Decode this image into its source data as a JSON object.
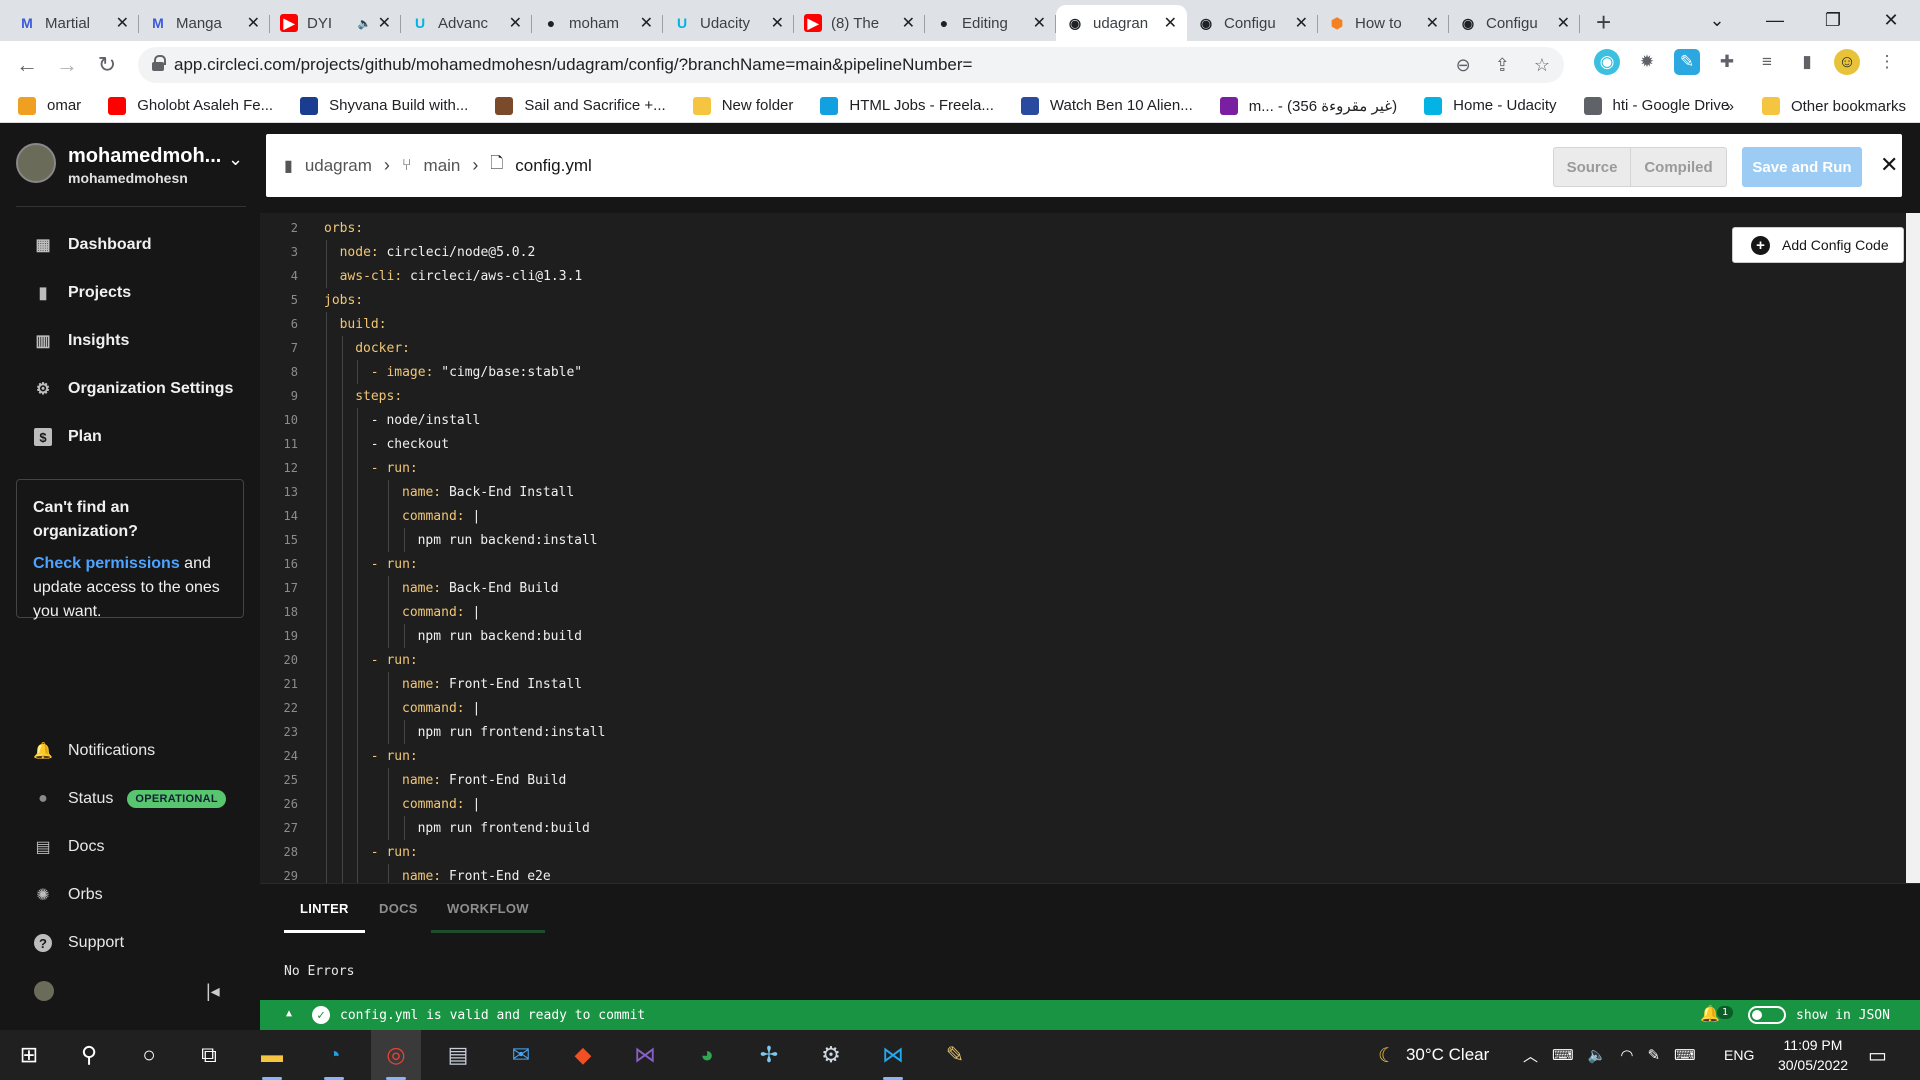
{
  "browser": {
    "tabs": [
      {
        "title": "Martial",
        "favicon": "M",
        "favcolor": "#3b5bdb",
        "favbg": "transparent"
      },
      {
        "title": "Manga",
        "favicon": "M",
        "favcolor": "#3b5bdb",
        "favbg": "transparent"
      },
      {
        "title": "DYI",
        "favicon": "▶",
        "favcolor": "#fff",
        "favbg": "#ff0000"
      },
      {
        "title": "Advanc",
        "favicon": "U",
        "favcolor": "#02b3e4",
        "favbg": "transparent"
      },
      {
        "title": "moham",
        "favicon": "●",
        "favcolor": "#202124",
        "favbg": "transparent"
      },
      {
        "title": "Udacity",
        "favicon": "U",
        "favcolor": "#02b3e4",
        "favbg": "transparent"
      },
      {
        "title": "(8) The",
        "favicon": "▶",
        "favcolor": "#fff",
        "favbg": "#ff0000"
      },
      {
        "title": "Editing",
        "favicon": "●",
        "favcolor": "#202124",
        "favbg": "transparent"
      },
      {
        "title": "udagran",
        "favicon": "◉",
        "favcolor": "#202124",
        "favbg": "transparent"
      },
      {
        "title": "Configu",
        "favicon": "◉",
        "favcolor": "#202124",
        "favbg": "transparent"
      },
      {
        "title": "How to",
        "favicon": "⬢",
        "favcolor": "#f48024",
        "favbg": "transparent"
      },
      {
        "title": "Configu",
        "favicon": "◉",
        "favcolor": "#202124",
        "favbg": "transparent"
      }
    ],
    "url": "app.circleci.com/projects/github/mohamedmohesn/udagram/config/?branchName=main&pipelineNumber=",
    "bookmarks": [
      {
        "label": "omar",
        "color": "#f0a020"
      },
      {
        "label": "Gholobt Asaleh Fe...",
        "color": "#ff0000"
      },
      {
        "label": "Shyvana Build with...",
        "color": "#1a3d8f"
      },
      {
        "label": "Sail and Sacrifice +...",
        "color": "#7a4a2a"
      },
      {
        "label": "New folder",
        "color": "#f5c542"
      },
      {
        "label": "HTML Jobs - Freela...",
        "color": "#13a0e0"
      },
      {
        "label": "Watch Ben 10 Alien...",
        "color": "#2a4aa0"
      },
      {
        "label": "m... - (356 غير مقروءة)",
        "color": "#7b1fa2"
      },
      {
        "label": "Home - Udacity",
        "color": "#02b3e4"
      },
      {
        "label": "hti - Google Drive",
        "color": "#5f6368"
      }
    ],
    "bookmarks_more": "»",
    "other_bookmarks": "Other bookmarks"
  },
  "sidebar": {
    "org_name": "mohamedmoh...",
    "org_user": "mohamedmohesn",
    "nav_top": [
      {
        "label": "Dashboard",
        "icon": "dashboard-icon"
      },
      {
        "label": "Projects",
        "icon": "projects-icon"
      },
      {
        "label": "Insights",
        "icon": "insights-icon"
      },
      {
        "label": "Organization Settings",
        "icon": "gear-icon"
      },
      {
        "label": "Plan",
        "icon": "dollar-icon"
      }
    ],
    "cant_find": {
      "heading": "Can't find an organization?",
      "link": "Check permissions",
      "text_after_link": " and",
      "text": "update access to the ones you want."
    },
    "nav_bottom": [
      {
        "label": "Notifications",
        "icon": "bell-icon"
      },
      {
        "label": "Status",
        "icon": "status-icon"
      },
      {
        "label": "Docs",
        "icon": "docs-icon"
      },
      {
        "label": "Orbs",
        "icon": "orbs-icon"
      },
      {
        "label": "Support",
        "icon": "help-icon"
      }
    ],
    "status_badge": "OPERATIONAL"
  },
  "header": {
    "breadcrumb": [
      "udagram",
      "main",
      "config.yml"
    ],
    "source_label": "Source",
    "compiled_label": "Compiled",
    "save_run_label": "Save and Run"
  },
  "editor": {
    "add_config_label": "Add Config Code",
    "lines": [
      {
        "n": "2",
        "indent": 0,
        "key": "orbs:",
        "val": ""
      },
      {
        "n": "3",
        "indent": 1,
        "key": "node:",
        "val": " circleci/node@5.0.2"
      },
      {
        "n": "4",
        "indent": 1,
        "key": "aws-cli:",
        "val": " circleci/aws-cli@1.3.1"
      },
      {
        "n": "5",
        "indent": 0,
        "key": "jobs:",
        "val": ""
      },
      {
        "n": "6",
        "indent": 1,
        "key": "build:",
        "val": ""
      },
      {
        "n": "7",
        "indent": 2,
        "key": "docker:",
        "val": ""
      },
      {
        "n": "8",
        "indent": 3,
        "key": "- image:",
        "val": " \"cimg/base:stable\""
      },
      {
        "n": "9",
        "indent": 2,
        "key": "steps:",
        "val": ""
      },
      {
        "n": "10",
        "indent": 3,
        "key": "",
        "val": "- node/install"
      },
      {
        "n": "11",
        "indent": 3,
        "key": "",
        "val": "- checkout"
      },
      {
        "n": "12",
        "indent": 3,
        "key": "- run:",
        "val": ""
      },
      {
        "n": "13",
        "indent": 5,
        "key": "name:",
        "val": " Back-End Install"
      },
      {
        "n": "14",
        "indent": 5,
        "key": "command:",
        "val": " |"
      },
      {
        "n": "15",
        "indent": 6,
        "key": "",
        "val": "npm run backend:install"
      },
      {
        "n": "16",
        "indent": 3,
        "key": "- run:",
        "val": ""
      },
      {
        "n": "17",
        "indent": 5,
        "key": "name:",
        "val": " Back-End Build"
      },
      {
        "n": "18",
        "indent": 5,
        "key": "command:",
        "val": " |"
      },
      {
        "n": "19",
        "indent": 6,
        "key": "",
        "val": "npm run backend:build"
      },
      {
        "n": "20",
        "indent": 3,
        "key": "- run:",
        "val": ""
      },
      {
        "n": "21",
        "indent": 5,
        "key": "name:",
        "val": " Front-End Install"
      },
      {
        "n": "22",
        "indent": 5,
        "key": "command:",
        "val": " |"
      },
      {
        "n": "23",
        "indent": 6,
        "key": "",
        "val": "npm run frontend:install"
      },
      {
        "n": "24",
        "indent": 3,
        "key": "- run:",
        "val": ""
      },
      {
        "n": "25",
        "indent": 5,
        "key": "name:",
        "val": " Front-End Build"
      },
      {
        "n": "26",
        "indent": 5,
        "key": "command:",
        "val": " |"
      },
      {
        "n": "27",
        "indent": 6,
        "key": "",
        "val": "npm run frontend:build"
      },
      {
        "n": "28",
        "indent": 3,
        "key": "- run:",
        "val": ""
      },
      {
        "n": "29",
        "indent": 5,
        "key": "name:",
        "val": " Front-End e2e"
      }
    ]
  },
  "bottom": {
    "tabs": [
      "LINTER",
      "DOCS",
      "WORKFLOW"
    ],
    "lint_result": "No Errors",
    "status_message": "config.yml is valid and ready to commit",
    "notification_count": "1",
    "json_toggle_label": "show in JSON"
  },
  "taskbar": {
    "weather": "30°C Clear",
    "language": "ENG",
    "time": "11:09 PM",
    "date": "30/05/2022"
  },
  "colors": {
    "accent": "#189443",
    "link": "#4da3ff",
    "save_run": "#9ccbf3",
    "yaml_key": "#f0c674"
  }
}
